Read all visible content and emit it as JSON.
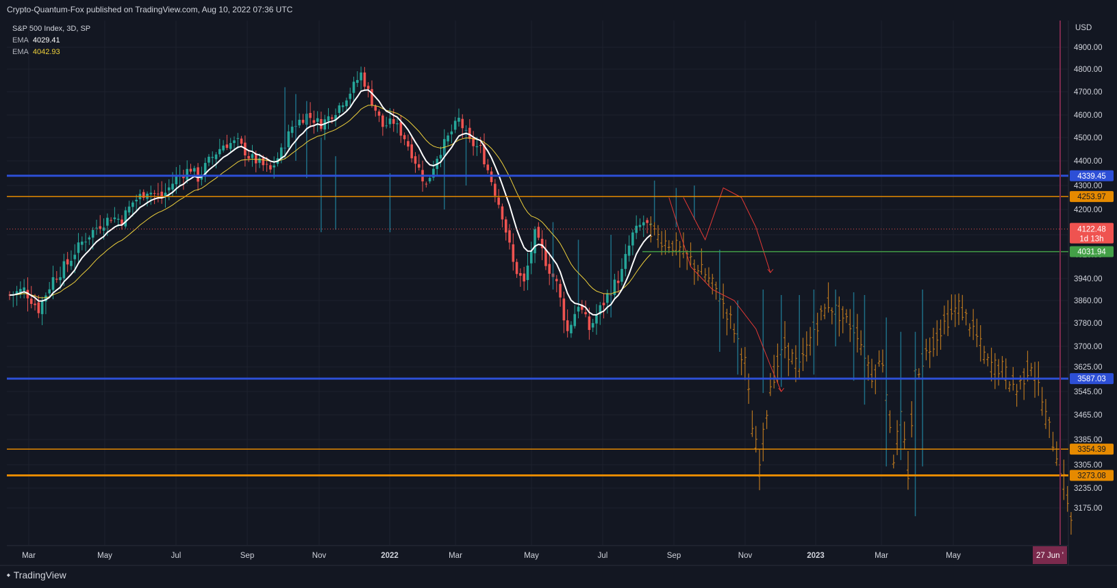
{
  "header": {
    "text": "Crypto-Quantum-Fox published on TradingView.com, Aug 10, 2022 07:36 UTC"
  },
  "legend": {
    "symbol": "S&P 500 Index, 3D, SP",
    "ema1_label": "EMA",
    "ema1_value": "4029.41",
    "ema2_label": "EMA",
    "ema2_value": "4042.93"
  },
  "footer": {
    "brand": "TradingView"
  },
  "colors": {
    "background": "#131722",
    "up": "#26a69a",
    "down": "#ef5350",
    "projected": "#b8761f",
    "projected_blue": "#1e6e86",
    "ema_fast": "#ffffff",
    "ema_slow": "#f0d23c",
    "blue_level": "#2d4fd6",
    "orange_level": "#e68a00",
    "green_level": "#43a047",
    "current_price": "#ef5350",
    "time_marker": "#7b2a4d"
  },
  "chart_data": {
    "type": "candlestick",
    "symbol": "S&P 500 Index",
    "interval": "3D",
    "currency": "USD",
    "y_axis_ticks": [
      4900,
      4800,
      4700,
      4600,
      4500,
      4400,
      4300,
      4200,
      4100,
      4020,
      3940,
      3860,
      3780,
      3700,
      3625,
      3545,
      3465,
      3385,
      3305,
      3235,
      3175
    ],
    "y_axis_tick_labels": [
      "4900.00",
      "4800.00",
      "4700.00",
      "4600.00",
      "4500.00",
      "4400.00",
      "4300.00",
      "4200.00",
      "4100.00",
      "4020.00",
      "3940.00",
      "3860.00",
      "3780.00",
      "3700.00",
      "3625.00",
      "3545.00",
      "3465.00",
      "3385.00",
      "3305.00",
      "3235.00",
      "3175.00"
    ],
    "x_axis_labels": [
      {
        "label": "Mar",
        "bold": false
      },
      {
        "label": "May",
        "bold": false
      },
      {
        "label": "Jul",
        "bold": false
      },
      {
        "label": "Sep",
        "bold": false
      },
      {
        "label": "Nov",
        "bold": false
      },
      {
        "label": "2022",
        "bold": true
      },
      {
        "label": "Mar",
        "bold": false
      },
      {
        "label": "May",
        "bold": false
      },
      {
        "label": "Jul",
        "bold": false
      },
      {
        "label": "Sep",
        "bold": false
      },
      {
        "label": "Nov",
        "bold": false
      },
      {
        "label": "2023",
        "bold": true
      },
      {
        "label": "Mar",
        "bold": false
      },
      {
        "label": "May",
        "bold": false
      }
    ],
    "time_marker_label": "27 Jun '",
    "horizontal_levels": [
      {
        "value": 4339.45,
        "label": "4339.45",
        "color": "#2d4fd6"
      },
      {
        "value": 4253.97,
        "label": "4253.97",
        "color": "#e68a00"
      },
      {
        "value": 4031.94,
        "label": "4031.94",
        "color": "#43a047"
      },
      {
        "value": 3587.03,
        "label": "3587.03",
        "color": "#2d4fd6"
      },
      {
        "value": 3354.39,
        "label": "3354.39",
        "color": "#e68a00"
      },
      {
        "value": 3273.08,
        "label": "3273.08",
        "color": "#e68a00"
      }
    ],
    "current_price": {
      "value": 4122.48,
      "label": "4122.48",
      "countdown": "1d 13h"
    },
    "ema_fast_last": 4029.41,
    "ema_slow_last": 4042.93,
    "price_path": [
      [
        0,
        3880
      ],
      [
        4,
        3900
      ],
      [
        8,
        3830
      ],
      [
        12,
        3940
      ],
      [
        16,
        3990
      ],
      [
        20,
        4070
      ],
      [
        24,
        4130
      ],
      [
        28,
        4170
      ],
      [
        31,
        4160
      ],
      [
        34,
        4230
      ],
      [
        38,
        4280
      ],
      [
        42,
        4250
      ],
      [
        46,
        4330
      ],
      [
        50,
        4370
      ],
      [
        52,
        4330
      ],
      [
        55,
        4400
      ],
      [
        59,
        4470
      ],
      [
        63,
        4480
      ],
      [
        66,
        4420
      ],
      [
        69,
        4390
      ],
      [
        72,
        4360
      ],
      [
        75,
        4440
      ],
      [
        78,
        4550
      ],
      [
        82,
        4600
      ],
      [
        86,
        4560
      ],
      [
        90,
        4620
      ],
      [
        94,
        4700
      ],
      [
        97,
        4780
      ],
      [
        100,
        4660
      ],
      [
        103,
        4550
      ],
      [
        106,
        4570
      ],
      [
        109,
        4500
      ],
      [
        112,
        4400
      ],
      [
        115,
        4300
      ],
      [
        118,
        4420
      ],
      [
        121,
        4500
      ],
      [
        124,
        4580
      ],
      [
        127,
        4480
      ],
      [
        130,
        4450
      ],
      [
        133,
        4320
      ],
      [
        136,
        4180
      ],
      [
        139,
        3990
      ],
      [
        142,
        3920
      ],
      [
        145,
        4100
      ],
      [
        148,
        4000
      ],
      [
        151,
        3920
      ],
      [
        154,
        3750
      ],
      [
        157,
        3850
      ],
      [
        160,
        3760
      ],
      [
        163,
        3830
      ],
      [
        166,
        3900
      ],
      [
        169,
        3960
      ],
      [
        172,
        4100
      ],
      [
        175,
        4150
      ],
      [
        177,
        4122.48
      ]
    ],
    "projected_path": [
      [
        177,
        4122
      ],
      [
        180,
        4080
      ],
      [
        184,
        4050
      ],
      [
        188,
        4000
      ],
      [
        192,
        3950
      ],
      [
        196,
        3880
      ],
      [
        200,
        3760
      ],
      [
        203,
        3640
      ],
      [
        205,
        3420
      ],
      [
        207,
        3300
      ],
      [
        210,
        3570
      ],
      [
        214,
        3700
      ],
      [
        218,
        3620
      ],
      [
        222,
        3760
      ],
      [
        226,
        3850
      ],
      [
        230,
        3800
      ],
      [
        234,
        3750
      ],
      [
        238,
        3600
      ],
      [
        241,
        3650
      ],
      [
        244,
        3330
      ],
      [
        246,
        3450
      ],
      [
        248,
        3280
      ],
      [
        250,
        3600
      ],
      [
        254,
        3700
      ],
      [
        258,
        3780
      ],
      [
        262,
        3840
      ],
      [
        266,
        3760
      ],
      [
        270,
        3640
      ],
      [
        274,
        3620
      ],
      [
        278,
        3550
      ],
      [
        282,
        3640
      ],
      [
        284,
        3560
      ],
      [
        286,
        3460
      ],
      [
        288,
        3380
      ],
      [
        290,
        3300
      ],
      [
        293,
        3150
      ]
    ],
    "projected_blue_bars": [
      [
        178,
        4150,
        4320
      ],
      [
        184,
        4130,
        4290
      ],
      [
        189,
        4160,
        4300
      ],
      [
        196,
        3680,
        4040
      ],
      [
        201,
        3600,
        3860
      ],
      [
        208,
        3540,
        3900
      ],
      [
        213,
        3560,
        3880
      ],
      [
        218,
        3620,
        3880
      ],
      [
        222,
        3600,
        3900
      ],
      [
        228,
        3700,
        3900
      ],
      [
        233,
        3580,
        3890
      ],
      [
        236,
        3500,
        3880
      ],
      [
        242,
        3300,
        3800
      ],
      [
        246,
        3320,
        3750
      ],
      [
        250,
        3150,
        3750
      ],
      [
        252,
        3300,
        3900
      ]
    ],
    "pattern_arrow_1": [
      [
        186,
        4250
      ],
      [
        192,
        4080
      ],
      [
        197,
        4290
      ],
      [
        202,
        4250
      ],
      [
        206,
        4130
      ],
      [
        210,
        3960
      ]
    ],
    "pattern_arrow_2": [
      [
        182,
        4250
      ],
      [
        188,
        3980
      ],
      [
        194,
        3900
      ],
      [
        200,
        3860
      ],
      [
        206,
        3760
      ],
      [
        210,
        3630
      ],
      [
        213,
        3545
      ]
    ]
  }
}
